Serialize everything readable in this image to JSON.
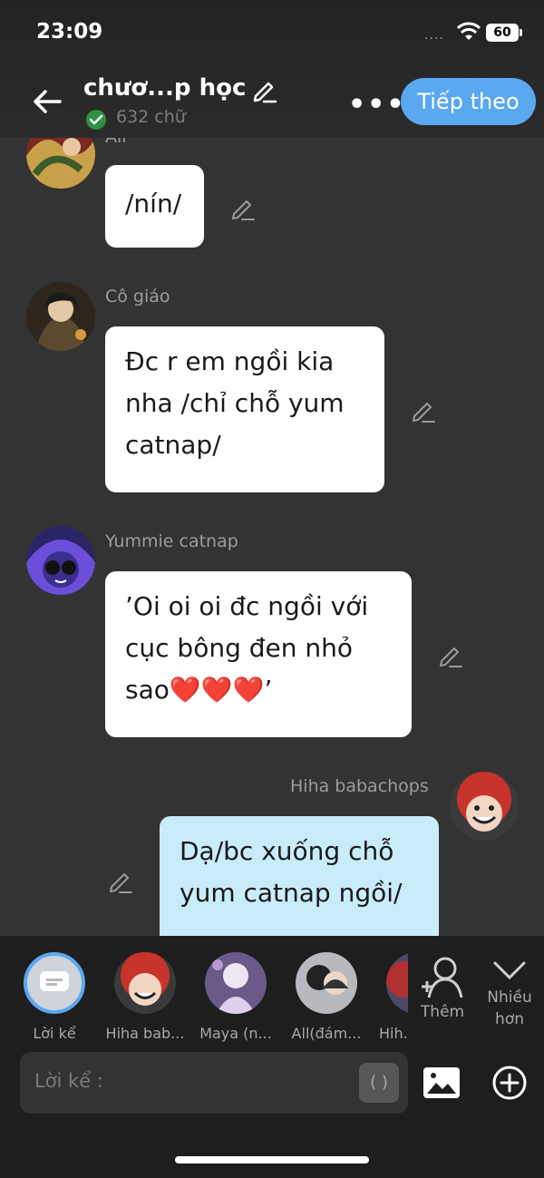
{
  "status": {
    "time": "23:09",
    "battery": "60",
    "signal": "....",
    "wifi_icon": "wifi-icon"
  },
  "header": {
    "title": "chươ...p học",
    "word_count": "632 chữ",
    "next_label": "Tiếp theo",
    "more_label": "•••"
  },
  "messages": [
    {
      "sender": "All",
      "text": "/nín/"
    },
    {
      "sender": "Cô giáo",
      "text": "Đc r em ngồi kia nha /chỉ chỗ yum catnap/"
    },
    {
      "sender": "Yummie catnap",
      "text": "’Oi oi oi đc ngồi với cục bông đen nhỏ sao❤️❤️❤️’"
    },
    {
      "sender": "Hiha babachops",
      "text": "Dạ/bc xuống chỗ yum catnap ngồi/"
    }
  ],
  "characters": [
    {
      "label": "Lời kể"
    },
    {
      "label": "Hiha bab..."
    },
    {
      "label": "Maya (n..."
    },
    {
      "label": "All(đám..."
    },
    {
      "label": "Hih..."
    }
  ],
  "actions": {
    "add_label": "Thêm",
    "more_label": "Nhiều\nhơn"
  },
  "composer": {
    "placeholder": "Lời kể :",
    "paren": "( )"
  },
  "colors": {
    "accent": "#5aa8f0",
    "background": "#333333",
    "bubble": "#ffffff",
    "bubble_self": "#c9ecfb"
  }
}
